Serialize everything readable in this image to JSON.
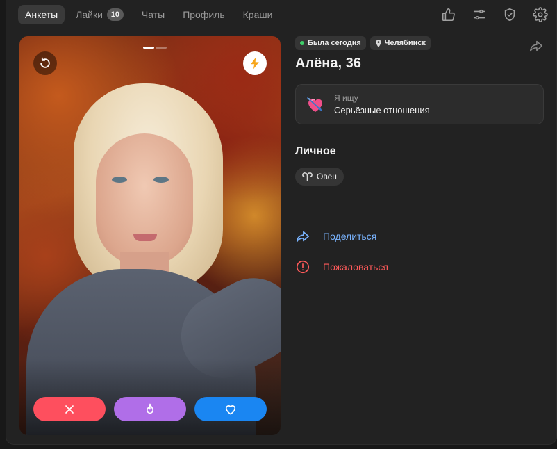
{
  "nav": {
    "tabs": [
      {
        "label": "Анкеты",
        "active": true
      },
      {
        "label": "Лайки",
        "badge": "10"
      },
      {
        "label": "Чаты"
      },
      {
        "label": "Профиль"
      },
      {
        "label": "Краши"
      }
    ],
    "icons": [
      "thumbs-up-icon",
      "sliders-icon",
      "shield-check-icon",
      "gear-icon"
    ]
  },
  "photo": {
    "slides_total": 2,
    "slide_active": 1
  },
  "profile": {
    "status": "Была сегодня",
    "city": "Челябинск",
    "name_age": "Алёна, 36",
    "seeking_label": "Я ищу",
    "seeking_value": "Серьёзные отношения",
    "personal_title": "Личное",
    "zodiac": "Овен"
  },
  "links": {
    "share": "Поделиться",
    "report": "Пожаловаться"
  },
  "colors": {
    "dislike": "#fe4f5e",
    "superlike": "#b06ee8",
    "like": "#1a86f2",
    "share_link": "#7ab4ff",
    "report_link": "#ff5a5a",
    "online": "#3fcf6a"
  }
}
